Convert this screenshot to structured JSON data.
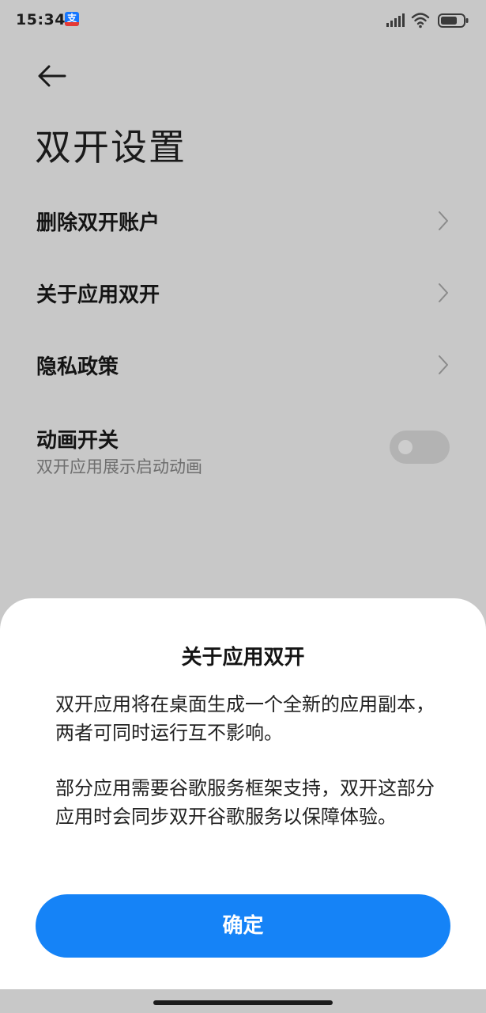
{
  "status_bar": {
    "time": "15:34",
    "notification_icon": "alipay-icon",
    "notification_glyph": "支",
    "icons": [
      "signal-icon",
      "wifi-icon",
      "battery-icon"
    ]
  },
  "header": {
    "back_icon": "back-arrow-icon",
    "title": "双开设置"
  },
  "settings": {
    "items": [
      {
        "label": "删除双开账户",
        "icon": "chevron-right-icon"
      },
      {
        "label": "关于应用双开",
        "icon": "chevron-right-icon"
      },
      {
        "label": "隐私政策",
        "icon": "chevron-right-icon"
      }
    ],
    "animation": {
      "title": "动画开关",
      "subtitle": "双开应用展示启动动画",
      "enabled": false
    }
  },
  "dialog": {
    "title": "关于应用双开",
    "paragraphs": [
      "双开应用将在桌面生成一个全新的应用副本，两者可同时运行互不影响。",
      "部分应用需要谷歌服务框架支持，双开这部分应用时会同步双开谷歌服务以保障体验。"
    ],
    "confirm_label": "确定"
  },
  "colors": {
    "accent": "#1583f7",
    "dim_background": "#c8c8c8",
    "sheet": "#ffffff"
  }
}
